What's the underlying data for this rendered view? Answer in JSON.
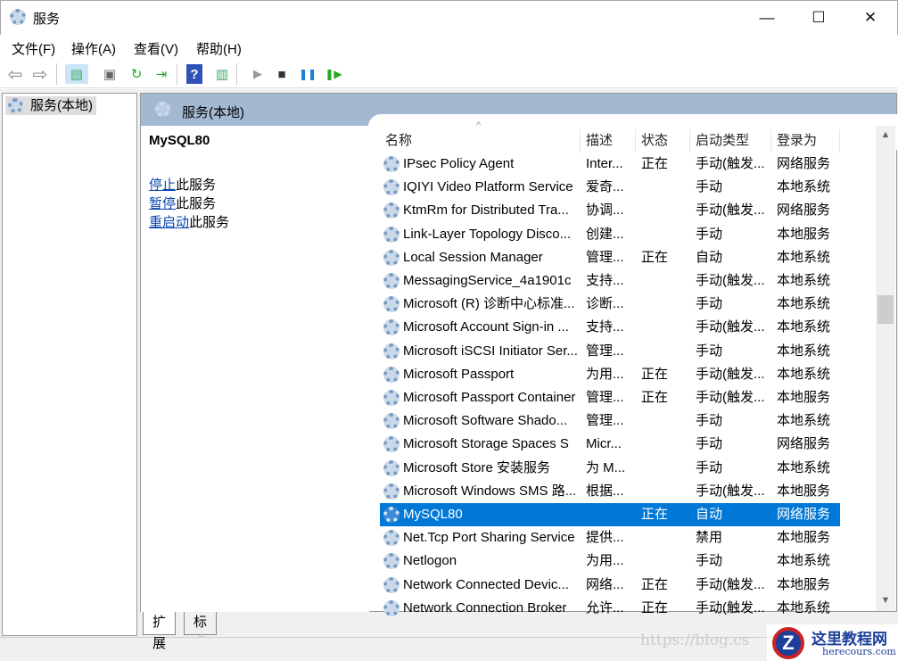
{
  "window": {
    "title": "服务",
    "minimize": "—",
    "maximize": "☐",
    "close": "✕"
  },
  "menu": [
    "文件(F)",
    "操作(A)",
    "查看(V)",
    "帮助(H)"
  ],
  "toolbar": {
    "back": "⇦",
    "forward": "⇨",
    "show_tree": "▤",
    "properties": "▣",
    "refresh": "↻",
    "export": "⇥",
    "help": "?",
    "show_action": "▥",
    "start": "▶",
    "stop": "■",
    "pause": "❚❚",
    "resume": "❚▶"
  },
  "tree": {
    "item": "服务(本地)"
  },
  "panel": {
    "header": "服务(本地)",
    "selected_service": "MySQL80",
    "actions": [
      {
        "link": "停止",
        "rest": "此服务"
      },
      {
        "link": "暂停",
        "rest": "此服务"
      },
      {
        "link": "重启动",
        "rest": "此服务"
      }
    ]
  },
  "columns": [
    "名称",
    "描述",
    "状态",
    "启动类型",
    "登录为"
  ],
  "sort_indicator": "^",
  "rows": [
    [
      "IPsec Policy Agent",
      "Inter...",
      "正在",
      "手动(触发...",
      "网络服务"
    ],
    [
      "IQIYI Video Platform Service",
      "爱奇...",
      "",
      "手动",
      "本地系统"
    ],
    [
      "KtmRm for Distributed Tra...",
      "协调...",
      "",
      "手动(触发...",
      "网络服务"
    ],
    [
      "Link-Layer Topology Disco...",
      "创建...",
      "",
      "手动",
      "本地服务"
    ],
    [
      "Local Session Manager",
      "管理...",
      "正在",
      "自动",
      "本地系统"
    ],
    [
      "MessagingService_4a1901c",
      "支持...",
      "",
      "手动(触发...",
      "本地系统"
    ],
    [
      "Microsoft (R) 诊断中心标准...",
      "诊断...",
      "",
      "手动",
      "本地系统"
    ],
    [
      "Microsoft Account Sign-in ...",
      "支持...",
      "",
      "手动(触发...",
      "本地系统"
    ],
    [
      "Microsoft iSCSI Initiator Ser...",
      "管理...",
      "",
      "手动",
      "本地系统"
    ],
    [
      "Microsoft Passport",
      "为用...",
      "正在",
      "手动(触发...",
      "本地系统"
    ],
    [
      "Microsoft Passport Container",
      "管理...",
      "正在",
      "手动(触发...",
      "本地服务"
    ],
    [
      "Microsoft Software Shado...",
      "管理...",
      "",
      "手动",
      "本地系统"
    ],
    [
      "Microsoft Storage Spaces S",
      "Micr...",
      "",
      "手动",
      "网络服务"
    ],
    [
      "Microsoft Store 安装服务",
      "为 M...",
      "",
      "手动",
      "本地系统"
    ],
    [
      "Microsoft Windows SMS 路...",
      "根据...",
      "",
      "手动(触发...",
      "本地服务"
    ],
    [
      "MySQL80",
      "",
      "正在",
      "自动",
      "网络服务"
    ],
    [
      "Net.Tcp Port Sharing Service",
      "提供...",
      "",
      "禁用",
      "本地服务"
    ],
    [
      "Netlogon",
      "为用...",
      "",
      "手动",
      "本地系统"
    ],
    [
      "Network Connected Devic...",
      "网络...",
      "正在",
      "手动(触发...",
      "本地服务"
    ],
    [
      "Network Connection Broker",
      "允许...",
      "正在",
      "手动(触发...",
      "本地系统"
    ]
  ],
  "selected_index": 15,
  "tabs": [
    "扩展",
    "标准"
  ],
  "watermark": "https://blog.cs",
  "logo": {
    "name": "这里教程网",
    "url": "herecours.com"
  },
  "colors": {
    "selection": "#0078d7",
    "header_band": "#a3b9d2",
    "link": "#0645ad"
  }
}
